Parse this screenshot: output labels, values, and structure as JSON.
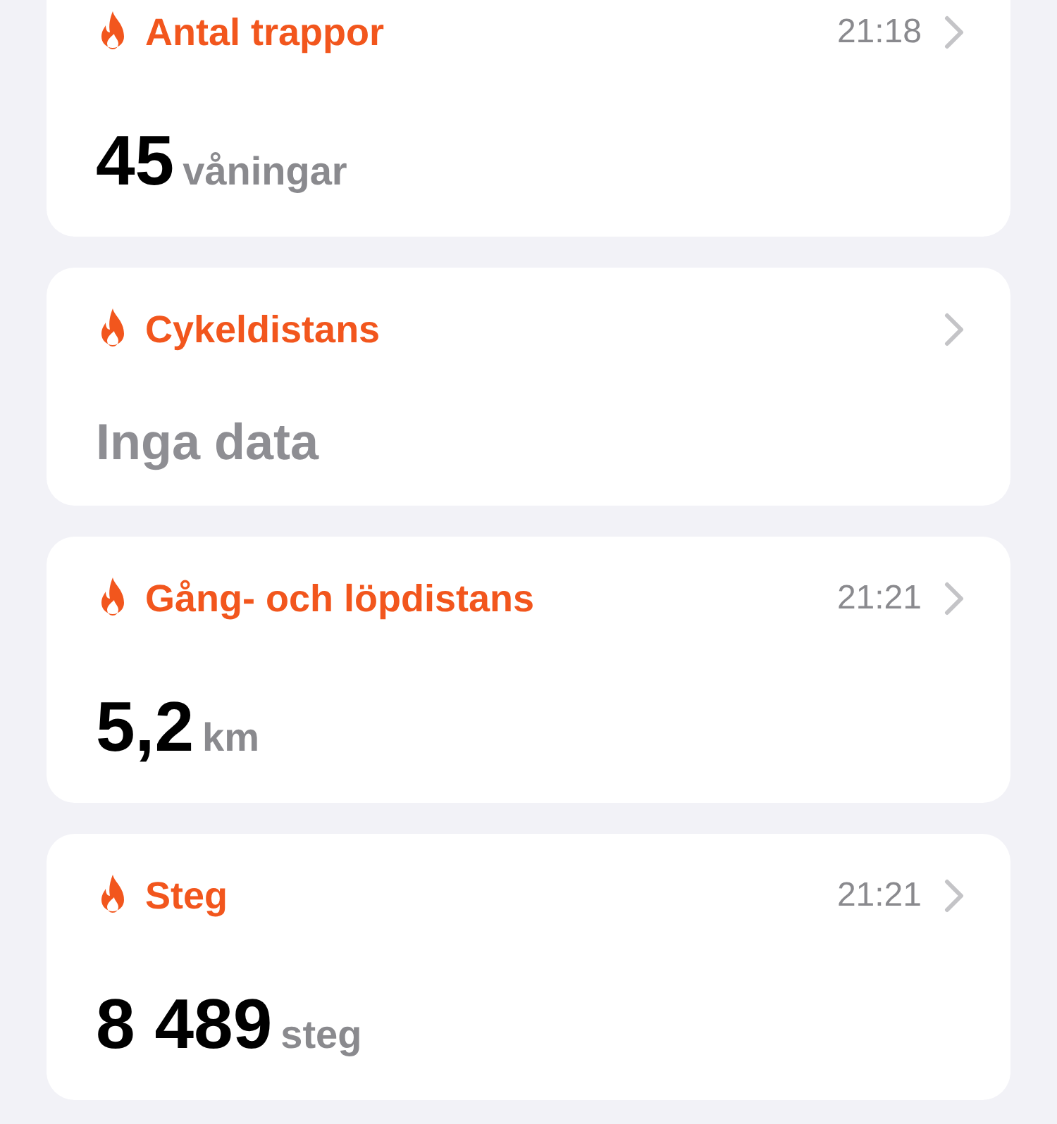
{
  "cards": [
    {
      "kind": "value",
      "title": "Antal trappor",
      "time": "21:18",
      "value": "45",
      "unit": "våningar"
    },
    {
      "kind": "empty",
      "title": "Cykeldistans",
      "value": "Inga data"
    },
    {
      "kind": "value",
      "title": "Gång- och löpdistans",
      "time": "21:21",
      "value": "5,2",
      "unit": "km"
    },
    {
      "kind": "value",
      "title": "Steg",
      "time": "21:21",
      "value": "8 489",
      "unit": "steg"
    }
  ]
}
